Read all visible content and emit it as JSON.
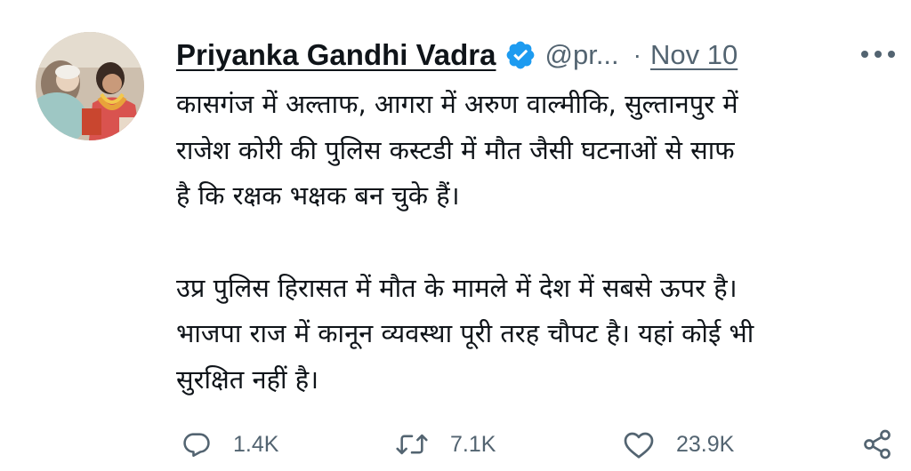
{
  "tweet": {
    "author": {
      "display_name": "Priyanka Gandhi Vadra",
      "handle": "@pr...",
      "verified_icon": "verified-badge-icon"
    },
    "separator": "·",
    "date": "Nov 10",
    "more_icon": "more-horizontal-icon",
    "body": {
      "paragraph_1": {
        "line_1": "कासगंज में अल्ताफ, आगरा में अरुण वाल्मीकि, सुल्तानपुर में",
        "line_2": "राजेश कोरी की पुलिस कस्टडी में मौत जैसी घटनाओं से साफ",
        "line_3": "है कि रक्षक भक्षक बन चुके हैं।"
      },
      "paragraph_2": {
        "line_1": "उप्र पुलिस हिरासत में मौत के मामले में देश में सबसे ऊपर है।",
        "line_2": "भाजपा राज में कानून व्यवस्था पूरी तरह चौपट है। यहां कोई भी",
        "line_3": "सुरक्षित नहीं है।"
      }
    },
    "actions": {
      "reply": {
        "icon": "reply-icon",
        "count": "1.4K"
      },
      "retweet": {
        "icon": "retweet-icon",
        "count": "7.1K"
      },
      "like": {
        "icon": "heart-icon",
        "count": "23.9K"
      },
      "share": {
        "icon": "share-icon"
      }
    },
    "colors": {
      "text_primary": "#0f1419",
      "text_secondary": "#536471",
      "verified_blue": "#1d9bf0",
      "background": "#ffffff"
    }
  }
}
